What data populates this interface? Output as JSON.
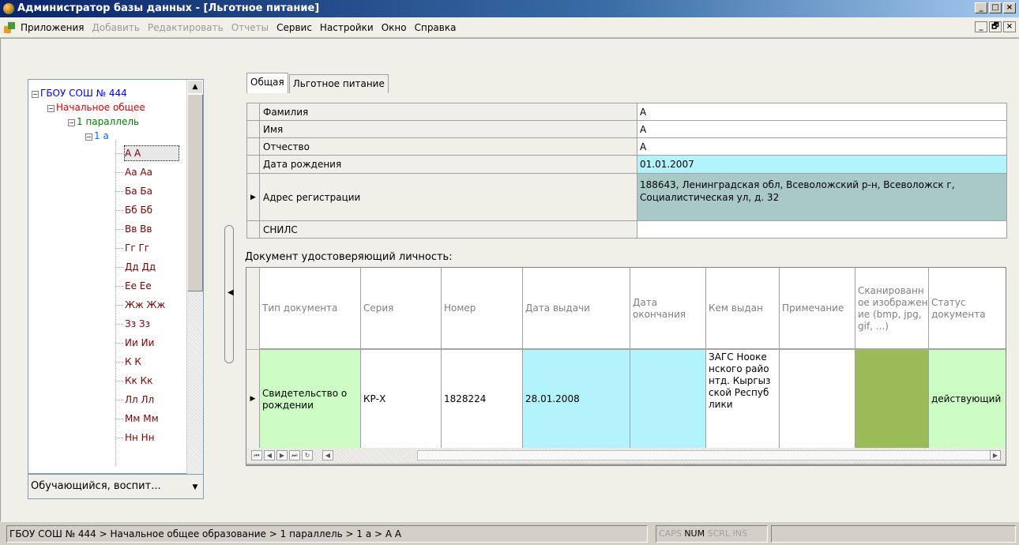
{
  "window": {
    "title": "Администратор базы данных - [Льготное питание]",
    "buttons": [
      "_",
      "□",
      "×"
    ]
  },
  "menu": {
    "items": [
      {
        "label": "Приложения",
        "enabled": true
      },
      {
        "label": "Добавить",
        "enabled": false
      },
      {
        "label": "Редактировать",
        "enabled": false
      },
      {
        "label": "Отчеты",
        "enabled": false
      },
      {
        "label": "Сервис",
        "enabled": true
      },
      {
        "label": "Настройки",
        "enabled": true
      },
      {
        "label": "Окно",
        "enabled": true
      },
      {
        "label": "Справка",
        "enabled": true
      }
    ],
    "mdi_buttons": [
      "_",
      "🗗",
      "×"
    ]
  },
  "tree": {
    "root": "ГБОУ СОШ № 444",
    "level1": "Начальное общее",
    "level2": "1 параллель",
    "level3": "1 а",
    "students": [
      "А А",
      "Аа Аа",
      "Ба Ба",
      "Бб Бб",
      "Вв Вв",
      "Гг Гг",
      "Дд Дд",
      "Ее Ее",
      "Жж Жж",
      "Зз Зз",
      "Ии Ии",
      "К К",
      "Кк Кк",
      "Лл Лл",
      "Мм Мм",
      "Нн Нн"
    ],
    "selected": "А А",
    "combo_value": "Обучающийся, воспит..."
  },
  "tabs": [
    {
      "label": "Общая",
      "active": true
    },
    {
      "label": "Льготное питание",
      "active": false
    }
  ],
  "form": {
    "rows": [
      {
        "label": "Фамилия",
        "value": "А"
      },
      {
        "label": "Имя",
        "value": "А"
      },
      {
        "label": "Отчество",
        "value": "А"
      },
      {
        "label": "Дата рождения",
        "value": "01.01.2007"
      },
      {
        "label": "Адрес регистрации",
        "value": "188643, Ленинградская обл, Всеволожский р-н, Всеволожск г, Социалистическая ул, д. 32"
      },
      {
        "label": "СНИЛС",
        "value": ""
      }
    ]
  },
  "doc_section_label": "Документ удостоверяющий личность:",
  "doc_grid": {
    "columns": [
      "Тип документа",
      "Серия",
      "Номер",
      "Дата выдачи",
      "Дата окончания",
      "Кем выдан",
      "Примечание",
      "Сканированное изображение (bmp, jpg, gif, ...)",
      "Статус документа"
    ],
    "row": [
      "Свидетельство о рождении",
      "КР-Х",
      "1828224",
      "28.01.2008",
      "",
      "ЗАГС Ноокенского районтд. Кыргызской Республики",
      "",
      "",
      "действующий"
    ]
  },
  "status": {
    "path": "ГБОУ СОШ № 444 > Начальное общее образование > 1 параллель > 1 а > А А",
    "caps": "CAPS",
    "num": "NUM",
    "scrl": "SCRL",
    "ins": "INS"
  }
}
